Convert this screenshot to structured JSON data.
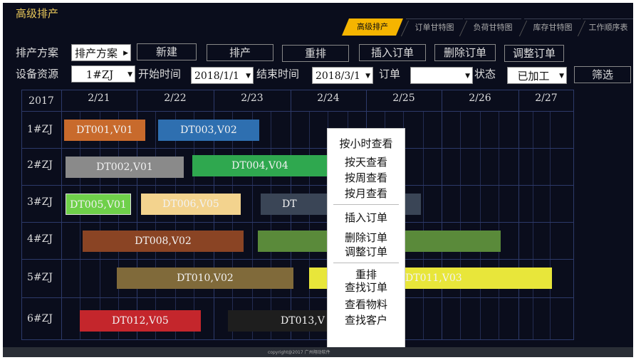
{
  "app": {
    "title": "高级排产"
  },
  "tabs": [
    {
      "label": "高级排产",
      "active": true
    },
    {
      "label": "订单甘特图"
    },
    {
      "label": "负荷甘特图"
    },
    {
      "label": "库存甘特图"
    },
    {
      "label": "工作顺序表"
    }
  ],
  "toolbar": {
    "plan_label": "排产方案",
    "plan_value": "排产方案",
    "new_label": "新建",
    "schedule_label": "排产",
    "reschedule_label": "重排",
    "insert_label": "插入订单",
    "delete_label": "删除订单",
    "adjust_label": "调整订单"
  },
  "filter": {
    "resource_label": "设备资源",
    "resource_value": "1#ZJ",
    "start_label": "开始时间",
    "start_value": "2018/1/1",
    "end_label": "结束时间",
    "end_value": "2018/3/1",
    "order_label": "订单",
    "order_value": "",
    "status_label": "状态",
    "status_value": "已加工",
    "filter_label": "筛选"
  },
  "gantt": {
    "year": "2017",
    "dates": [
      "2/21",
      "2/22",
      "2/23",
      "2/24",
      "2/25",
      "2/26",
      "2/27"
    ],
    "rows": [
      "1#ZJ",
      "2#ZJ",
      "3#ZJ",
      "4#ZJ",
      "5#ZJ",
      "6#ZJ"
    ],
    "bars": [
      {
        "label": "DT001,V01",
        "color": "#c86a2c"
      },
      {
        "label": "DT003,V02",
        "color": "#2e6fb0"
      },
      {
        "label": "DT002,V01",
        "color": "#8a8a8a"
      },
      {
        "label": "DT004,V04",
        "color": "#2fa84f"
      },
      {
        "label": "DT005,V01",
        "color": "#6fd04a"
      },
      {
        "label": "DT006,V05",
        "color": "#f3d38e"
      },
      {
        "label": "DT",
        "color": "#3a4556"
      },
      {
        "label": "",
        "color": "#3a4556"
      },
      {
        "label": "DT008,V02",
        "color": "#8a4424"
      },
      {
        "label": "",
        "color": "#5a8a3a"
      },
      {
        "label": "",
        "color": "#5a8a3a"
      },
      {
        "label": "DT010,V02",
        "color": "#806a3a"
      },
      {
        "label": "",
        "color": "#e8e63a"
      },
      {
        "label": "DT011,V03",
        "color": "#e8e63a"
      },
      {
        "label": "DT012,V05",
        "color": "#c4262c"
      },
      {
        "label": "DT013,V",
        "color": "#1e1e1e"
      }
    ]
  },
  "context_menu": {
    "items": [
      "按小时查看",
      "按天查看",
      "按周查看",
      "按月查看",
      "插入订单",
      "删除订单",
      "调整订单",
      "重排",
      "查找订单",
      "查看物料",
      "查找客户"
    ]
  },
  "footer": {
    "copyright": "copyright@2017 广州翔动软件"
  }
}
